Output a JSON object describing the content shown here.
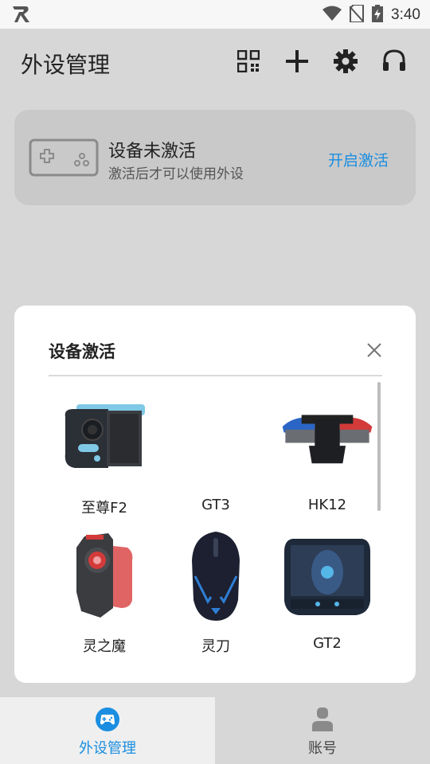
{
  "status_bar": {
    "time": "3:40"
  },
  "header": {
    "title": "外设管理"
  },
  "activation_card": {
    "title": "设备未激活",
    "subtitle": "激活后才可以使用外设",
    "action": "开启激活"
  },
  "dialog": {
    "title": "设备激活",
    "devices": [
      {
        "name": "至尊F2"
      },
      {
        "name": "GT3"
      },
      {
        "name": "HK12"
      },
      {
        "name": "灵之魔"
      },
      {
        "name": "灵刀"
      },
      {
        "name": "GT2"
      }
    ]
  },
  "bottom_nav": {
    "items": [
      {
        "label": "外设管理"
      },
      {
        "label": "账号"
      }
    ]
  },
  "colors": {
    "accent": "#1a8ee0",
    "card": "#c9c9c9",
    "background": "#d7d7d7"
  }
}
